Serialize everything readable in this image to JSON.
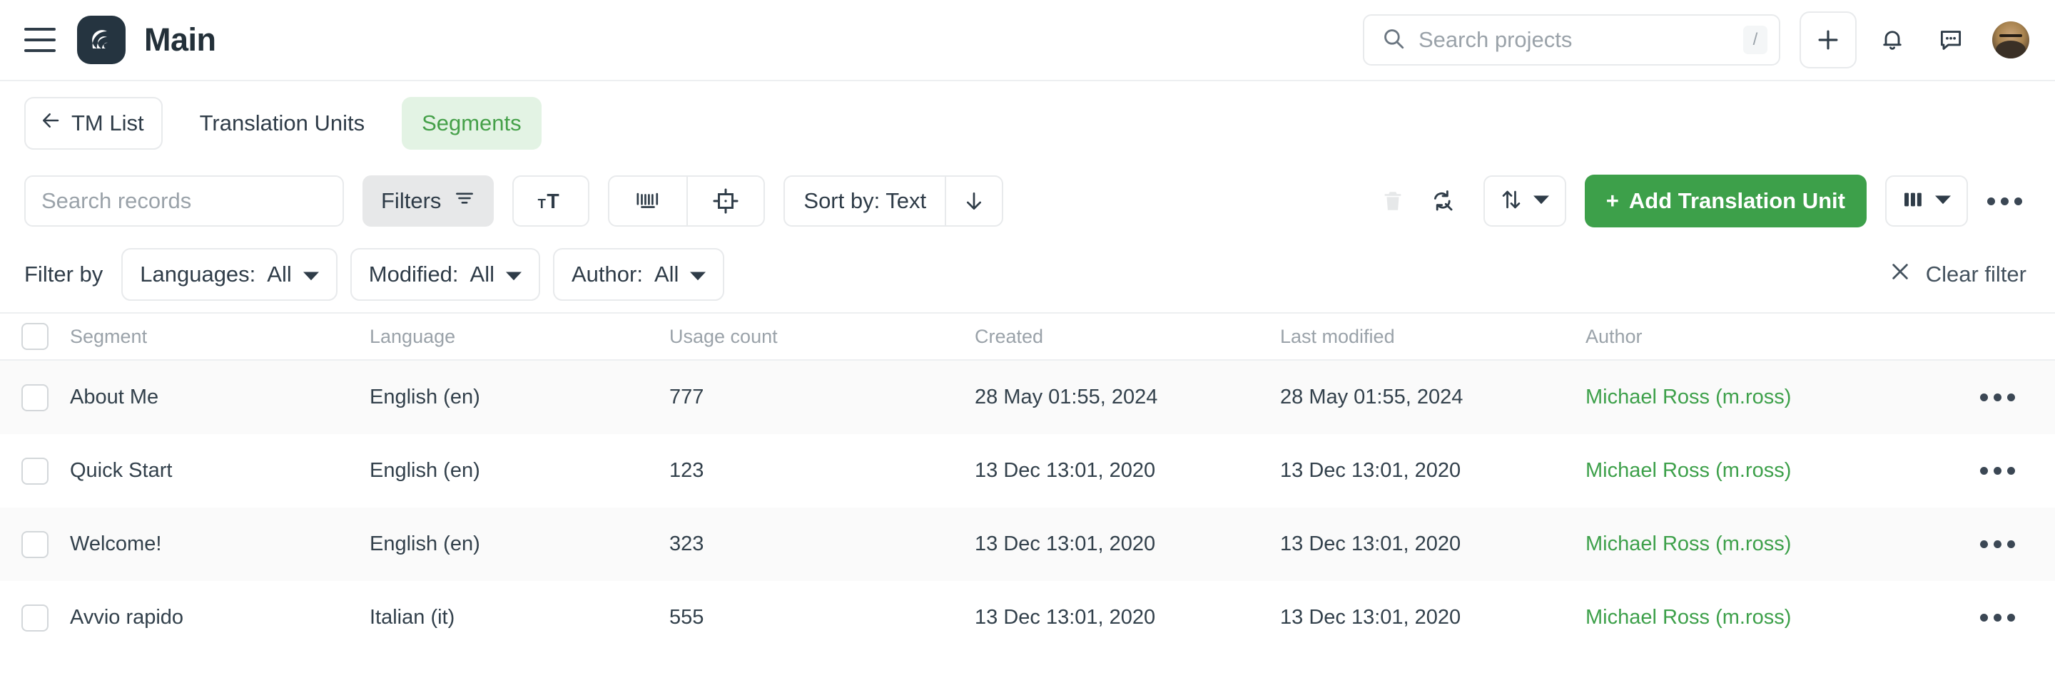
{
  "topbar": {
    "title": "Main",
    "menu_icon": "hamburger-icon",
    "logo_icon": "app-logo-icon",
    "search": {
      "placeholder": "Search projects",
      "value": "",
      "shortcut": "/"
    },
    "add_icon": "plus-icon",
    "notifications_icon": "bell-icon",
    "messages_icon": "chat-bubble-icon",
    "avatar_icon": "user-avatar"
  },
  "tabs": {
    "back_label": "TM List",
    "items": [
      {
        "label": "Translation Units",
        "active": false
      },
      {
        "label": "Segments",
        "active": true
      }
    ]
  },
  "toolbar": {
    "search": {
      "placeholder": "Search records",
      "value": ""
    },
    "filters_label": "Filters",
    "text_size_icon": "text-size-icon",
    "tags_icon": "barcode-tag-icon",
    "placeholder_icon": "crosshair-target-icon",
    "sort_label": "Sort by: Text",
    "sort_direction_icon": "arrow-down-icon",
    "delete_icon": "trash-icon",
    "refresh_search_icon": "refresh-search-icon",
    "reorder_icon": "arrows-up-down-icon",
    "add_button_label": "Add Translation Unit",
    "add_button_plus": "+",
    "columns_icon": "columns-icon",
    "more_icon": "more-horizontal-icon"
  },
  "filter_bar": {
    "label": "Filter by",
    "pills": [
      {
        "name": "Languages:",
        "value": "All"
      },
      {
        "name": "Modified:",
        "value": "All"
      },
      {
        "name": "Author:",
        "value": "All"
      }
    ],
    "clear_label": "Clear filter",
    "clear_icon": "close-icon"
  },
  "table": {
    "columns": [
      "Segment",
      "Language",
      "Usage count",
      "Created",
      "Last modified",
      "Author"
    ],
    "rows": [
      {
        "segment": "About Me",
        "language": "English (en)",
        "usage_count": "777",
        "created": "28 May 01:55, 2024",
        "last_modified": "28 May 01:55, 2024",
        "author": "Michael Ross (m.ross)"
      },
      {
        "segment": "Quick Start",
        "language": "English (en)",
        "usage_count": "123",
        "created": "13 Dec 13:01, 2020",
        "last_modified": "13 Dec 13:01, 2020",
        "author": "Michael Ross (m.ross)"
      },
      {
        "segment": "Welcome!",
        "language": "English (en)",
        "usage_count": "323",
        "created": "13 Dec 13:01, 2020",
        "last_modified": "13 Dec 13:01, 2020",
        "author": "Michael Ross (m.ross)"
      },
      {
        "segment": "Avvio rapido",
        "language": "Italian (it)",
        "usage_count": "555",
        "created": "13 Dec 13:01, 2020",
        "last_modified": "13 Dec 13:01, 2020",
        "author": "Michael Ross (m.ross)"
      }
    ]
  },
  "colors": {
    "accent_green": "#3da04a",
    "active_tab_bg": "#e3f3e4",
    "active_tab_text": "#45a049",
    "text_primary": "#2f3c48",
    "text_muted": "#9aa2a9",
    "row_alt_bg": "#fafafa",
    "border": "#e8eaec"
  }
}
